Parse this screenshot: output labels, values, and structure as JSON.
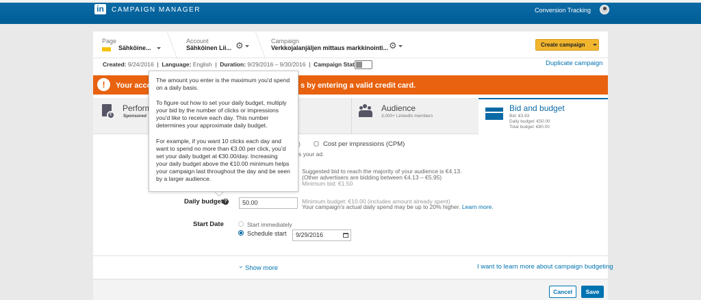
{
  "app": {
    "logo": "in",
    "title": "CAMPAIGN MANAGER"
  },
  "topbar": {
    "conversion_tracking": "Conversion Tracking"
  },
  "breadcrumb": {
    "page": {
      "label": "Page",
      "value": "Sähköine..."
    },
    "account": {
      "label": "Account",
      "value": "Sähköinen Lii..."
    },
    "campaign": {
      "label": "Campaign",
      "value": "Verkkojalanjäljen mittaus markkinointi..."
    }
  },
  "create_campaign": "Create campaign",
  "meta": {
    "created_label": "Created:",
    "created_value": "9/24/2016",
    "language_label": "Language:",
    "language_value": "English",
    "duration_label": "Duration:",
    "duration_value": "9/29/2016 – 9/30/2016",
    "status_label": "Campaign Status:",
    "status_on": false
  },
  "duplicate_campaign": "Duplicate campaign",
  "banner": {
    "icon": "!",
    "text_start": "Your acco",
    "text_end": "s by entering a valid credit card.",
    "color": "#e8620f"
  },
  "tabs": {
    "performance": {
      "title": "Perform",
      "sub": "Sponsored"
    },
    "audience": {
      "title": "Audience",
      "sub": "3,000+ LinkedIn members"
    },
    "bid": {
      "title": "Bid and budget",
      "bid": "Bid: €3.93",
      "daily": "Daily budget: €50.00",
      "total": "Total budget: €80.00"
    }
  },
  "form": {
    "cpc_paren": ")",
    "cpm_label": "Cost per impressions (CPM)",
    "ad_text": "s your ad.",
    "suggested_1": "Suggested bid to reach the majority of your audience is €4.13.",
    "suggested_2": "(Other advertisers are bidding between €4.13 – €5.95)",
    "minimum_bid": "Minimum bid: €1.50",
    "daily_budget_label": "Daily budget",
    "help_icon": "?",
    "daily_budget_value": "50.00",
    "budget_note_1": "Minimum budget: €10.00 (includes amount already spent)",
    "budget_note_2": "Your campaign's actual daily spend may be up to 20% higher.",
    "learn_more": "Learn more.",
    "start_date_label": "Start Date",
    "start_immediately": "Start immediately",
    "schedule_start": "Schedule start",
    "start_date_value": "9/29/2016"
  },
  "show_more": "Show more",
  "learn_budgeting": "I want to learn more about campaign budgeting",
  "footer": {
    "cancel": "Cancel",
    "save": "Save"
  },
  "tooltip": {
    "p1": "The amount you enter is the maximum you'd spend on a daily basis.",
    "p2": "To figure out how to set your daily budget, multiply your bid by the number of clicks or impressions you'd like to receive each day. This number determines your approximate daily budget.",
    "p3": "For example, if you want 10 clicks each day and want to spend no more than €3.00 per click, you'd set your daily budget at €30.00/day. Increasing your daily budget above the €10.00 minimum helps your campaign last throughout the day and be seen by a larger audience."
  },
  "colors": {
    "brand": "#0b6aa5",
    "link": "#0073b1",
    "accent": "#f1b52e"
  }
}
